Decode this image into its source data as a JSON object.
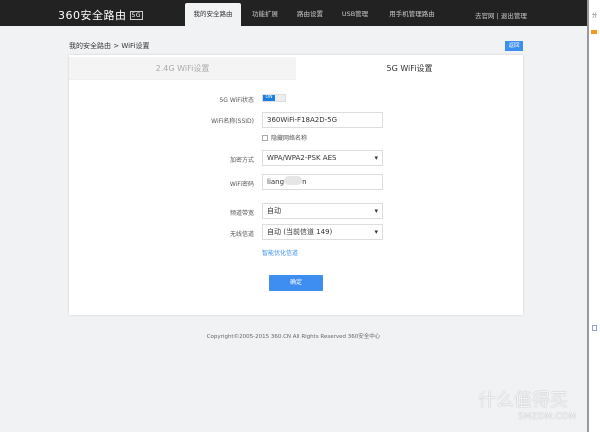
{
  "header": {
    "logo": "360安全路由",
    "logo_badge": "5G",
    "nav": [
      "我的安全路由",
      "功能扩展",
      "路由设置",
      "USB管理",
      "用手机管理路由"
    ],
    "active_nav": 0,
    "links": [
      "去官网",
      "退出管理"
    ]
  },
  "breadcrumb": "我的安全路由 > WiFi设置",
  "back_label": "返回",
  "tabs": [
    "2.4G WiFi设置",
    "5G WiFi设置"
  ],
  "active_tab": 1,
  "form": {
    "status_label": "5G WiFi状态",
    "status_toggle": "ON",
    "ssid_label": "WiFi名称(SSID)",
    "ssid_value": "360WiFi-F18A2D-5G",
    "hide_label": "隐藏网络名称",
    "hide_checked": false,
    "enc_label": "加密方式",
    "enc_value": "WPA/WPA2-PSK AES",
    "pwd_label": "WiFi密码",
    "pwd_value_start": "liang",
    "pwd_value_end": "n",
    "bw_label": "频道带宽",
    "bw_value": "自动",
    "ch_label": "无线信道",
    "ch_value": "自动 (当前信道 149)",
    "optimize_link": "智能优化信道",
    "submit": "确定"
  },
  "footer": "Copyright©2005-2015 360.CN All Rights Reserved 360安全中心",
  "side": {
    "text": "分"
  },
  "watermark": {
    "main": "什么值得买",
    "sub": "SMZDM.COM"
  },
  "colors": {
    "header": "#222222",
    "accent": "#3d8ef0"
  }
}
